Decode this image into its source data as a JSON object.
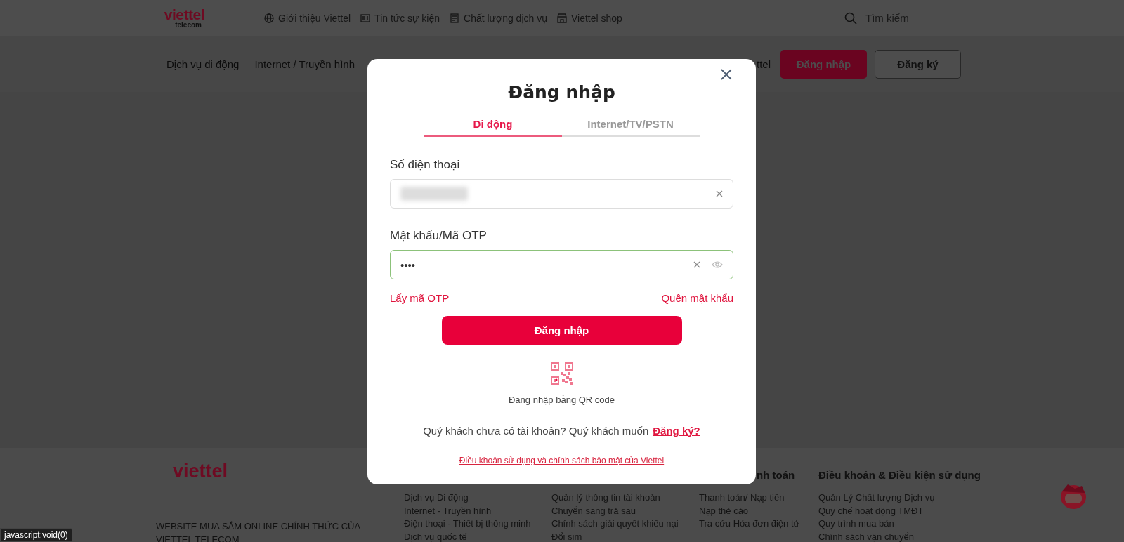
{
  "header": {
    "logo": {
      "brand": "viettel",
      "sub": "telecom"
    },
    "nav": [
      {
        "label": "Giới thiệu Viettel",
        "kind": "globe"
      },
      {
        "label": "Tin tức sự kiện",
        "kind": "news"
      },
      {
        "label": "Chất lượng dịch vụ",
        "kind": "book"
      },
      {
        "label": "Viettel shop",
        "kind": "shop"
      }
    ],
    "search": {
      "placeholder": "Tìm kiếm"
    }
  },
  "menu": {
    "items": [
      "Dịch vụ di động",
      "Internet / Truyền hình"
    ],
    "partial_item": "ttel",
    "login_button": "Đăng nhập",
    "register_button": "Đăng ký"
  },
  "modal": {
    "title": "Đăng nhập",
    "tabs": [
      {
        "label": "Di động",
        "selected": true
      },
      {
        "label": "Internet/TV/PSTN",
        "selected": false
      }
    ],
    "fields": [
      {
        "label": "Số điện thoại",
        "kind": "phone",
        "value_hidden": true,
        "focused": false,
        "clearable": true
      },
      {
        "label": "Mật khẩu/Mã OTP",
        "kind": "password",
        "value": "••••",
        "focused": true,
        "clearable": true
      }
    ],
    "otp_link": "Lấy mã OTP",
    "forgot_link": "Quên mật khẩu",
    "submit": "Đăng nhập",
    "qr_label": "Đăng nhập bằng QR code",
    "signup_text": "Quý khách chưa có tài khoản? Quý khách muốn",
    "signup_link": "Đăng ký?",
    "terms_link": "Điều khoản sử dụng và chính sách bảo mật của Viettel"
  },
  "footer": {
    "logo": "viettel",
    "tagline": [
      "WEBSITE MUA SẮM ONLINE CHÍNH THỨC CỦA",
      "VIETTEL TELECOM"
    ],
    "columns": [
      {
        "items": [
          "Dịch vụ Di động",
          "Internet - Truyền hình",
          "Điện thoại - Thiết bị thông minh",
          "Dịch vụ quốc tế"
        ]
      },
      {
        "items": [
          "Quản lý thông tin tài khoản",
          "Chuyển sang trả sau",
          "Chính sách giải quyết khiếu nại",
          "Đổi sim"
        ]
      },
      {
        "heading": "nh toán",
        "items": [
          "Thanh toán/ Nạp tiền",
          "Nạp thẻ cào",
          "Tra cứu Hóa đơn điện tử"
        ]
      },
      {
        "heading": "Điều khoản & Điều kiện sử dụng",
        "items": [
          "Quản Lý Chất lượng Dịch vụ",
          "Quy chế hoạt động TMĐT",
          "Quy trình mua bán",
          "Chính sách vận chuyển"
        ]
      }
    ]
  },
  "status_bar": "javascript:void(0)"
}
